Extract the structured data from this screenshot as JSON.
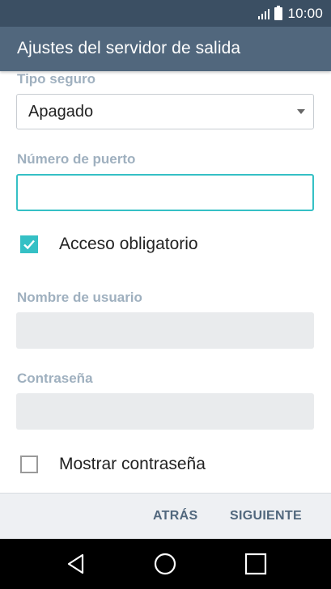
{
  "status_bar": {
    "time": "10:00",
    "icons": [
      "signal-icon",
      "battery-icon"
    ]
  },
  "app_bar": {
    "title": "Ajustes del servidor de salida"
  },
  "form": {
    "security_type": {
      "label": "Tipo seguro",
      "selected_value": "Apagado"
    },
    "port": {
      "label": "Número de puerto",
      "value": ""
    },
    "auth_required": {
      "label": "Acceso obligatorio",
      "checked": true
    },
    "username": {
      "label": "Nombre de usuario",
      "value": ""
    },
    "password": {
      "label": "Contraseña",
      "value": ""
    },
    "show_password": {
      "label": "Mostrar contraseña",
      "checked": false
    }
  },
  "actions": {
    "back_label": "ATRÁS",
    "next_label": "SIGUIENTE"
  },
  "nav_bar": {
    "buttons": [
      "back-triangle-icon",
      "home-circle-icon",
      "recents-square-icon"
    ]
  },
  "colors": {
    "status_bar": "#3b4f63",
    "app_bar": "#51677d",
    "accent": "#35c0c5",
    "label": "#9fb0bf",
    "disabled_field": "#e9ebed",
    "action_bar": "#eef0f3",
    "action_text": "#51677d"
  }
}
